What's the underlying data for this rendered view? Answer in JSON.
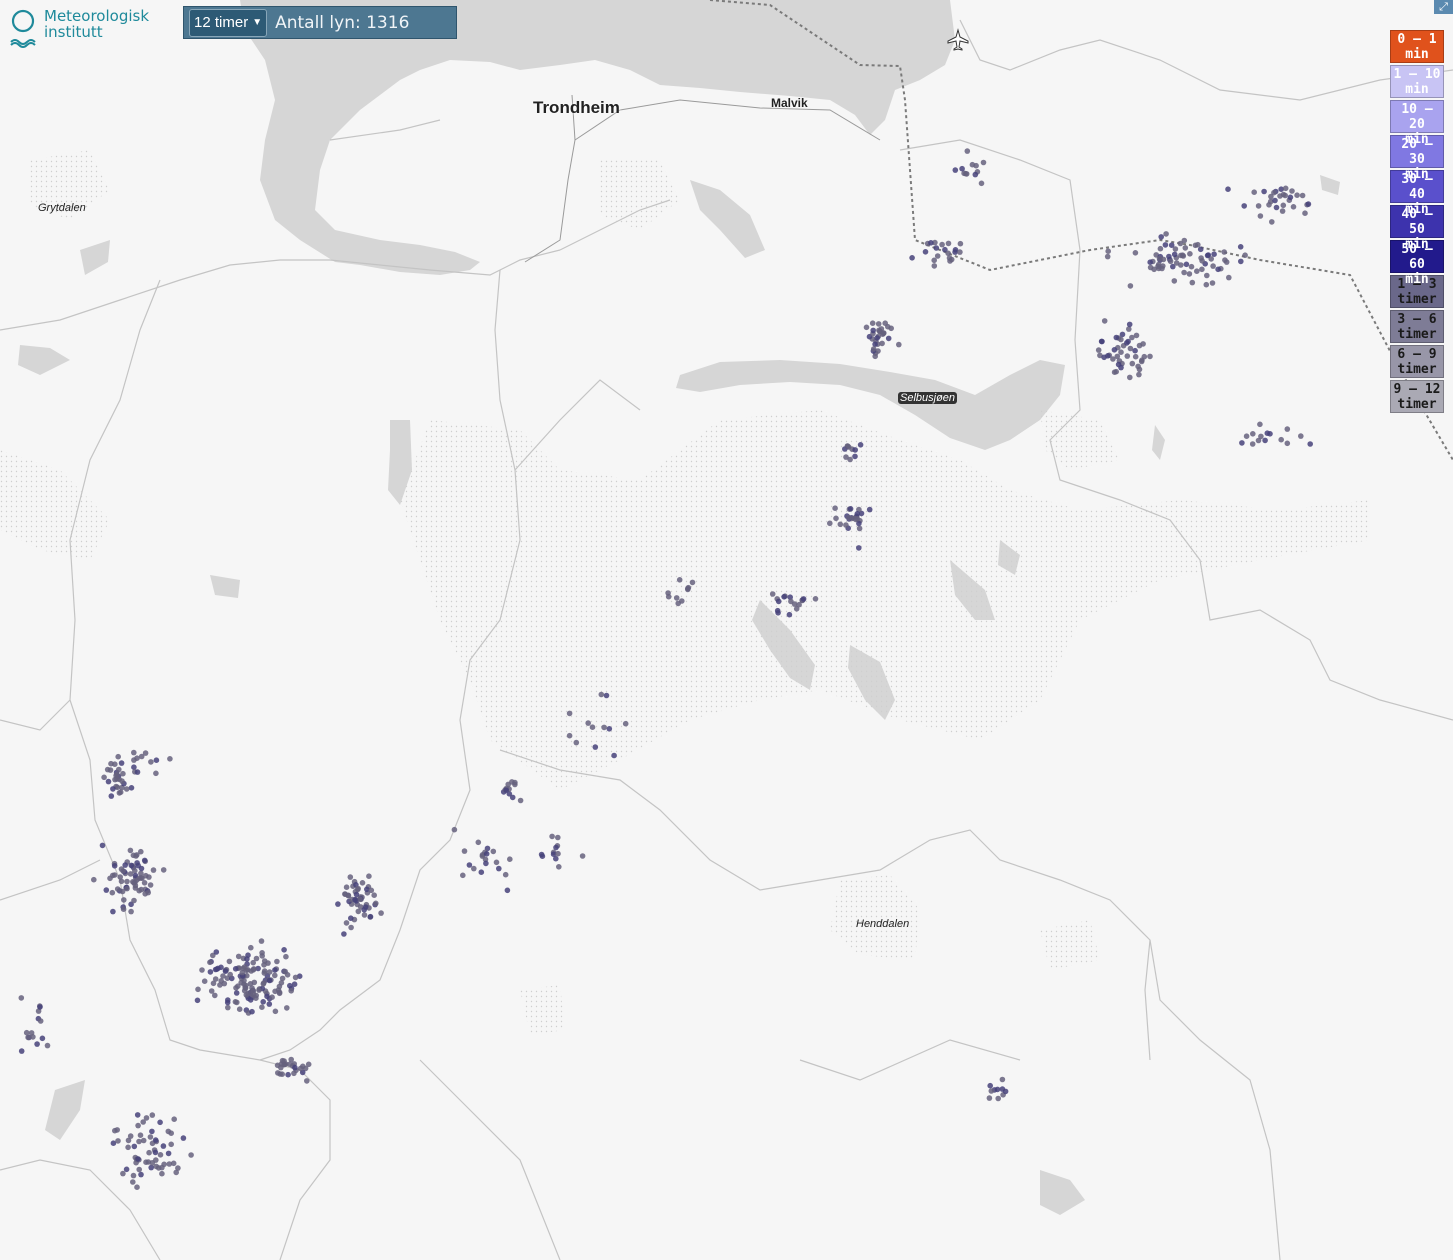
{
  "logo": {
    "line1": "Meteorologisk",
    "line2": "institutt"
  },
  "control": {
    "period_selected": "12 timer",
    "count_label": "Antall lyn: 1316"
  },
  "legend": [
    {
      "line1": "0 – 1",
      "line2": "min",
      "color": "#e0521c"
    },
    {
      "line1": "1 – 10",
      "line2": "min",
      "color": "#c8c4f4"
    },
    {
      "line1": "10 – 20",
      "line2": "min",
      "color": "#a9a3ef"
    },
    {
      "line1": "20 – 30",
      "line2": "min",
      "color": "#8078e2"
    },
    {
      "line1": "30 – 40",
      "line2": "min",
      "color": "#5a50cc"
    },
    {
      "line1": "40 – 50",
      "line2": "min",
      "color": "#3d33ad"
    },
    {
      "line1": "50 – 60",
      "line2": "min",
      "color": "#221a8c"
    },
    {
      "line1": "1 – 3",
      "line2": "timer",
      "color": "#6a688a"
    },
    {
      "line1": "3 – 6",
      "line2": "timer",
      "color": "#7e7c96"
    },
    {
      "line1": "6 – 9",
      "line2": "timer",
      "color": "#9896a8"
    },
    {
      "line1": "9 – 12",
      "line2": "timer",
      "color": "#aaa9b4"
    }
  ],
  "places": {
    "trondheim": "Trondheim",
    "malvik": "Malvik",
    "grytdalen": "Grytdalen",
    "selbusjoen": "Selbusjøen",
    "henddalen": "Henddalen"
  },
  "colors": {
    "water": "#d6d6d6",
    "land": "#f6f6f6",
    "strike": "#5e5a80"
  }
}
